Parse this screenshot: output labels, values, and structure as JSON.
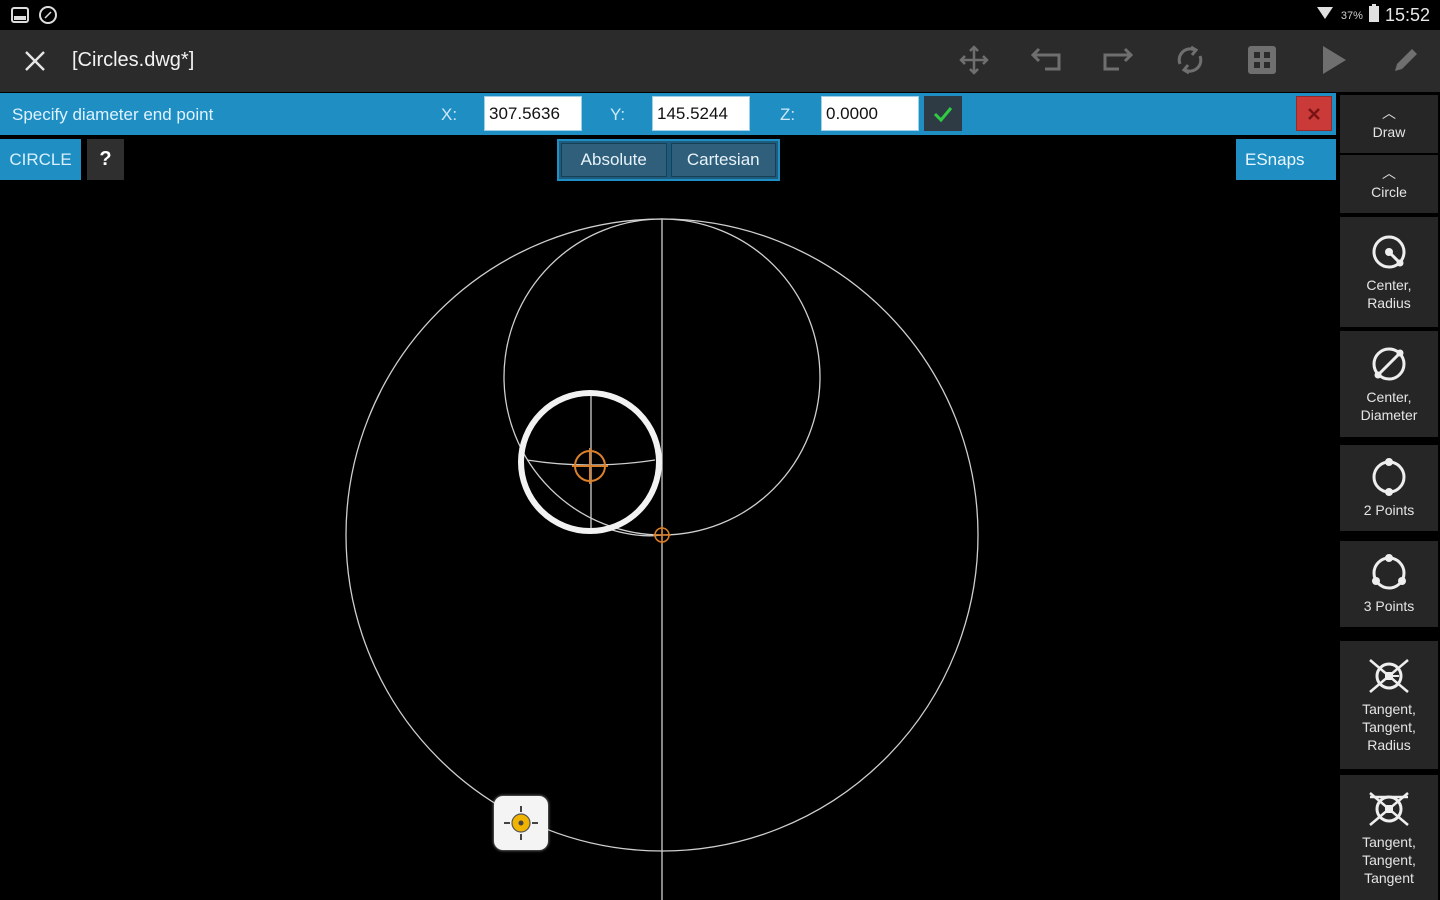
{
  "status_bar": {
    "left_icons": [
      "gallery-icon",
      "compass-icon"
    ],
    "battery": "37%",
    "time": "15:52"
  },
  "toolbar": {
    "document_title": "[Circles.dwg*]",
    "icons": [
      "move-icon",
      "undo-icon",
      "redo-icon",
      "refresh-icon",
      "grid-icon",
      "play-icon",
      "pencil-icon"
    ]
  },
  "command_bar": {
    "prompt": "Specify diameter end point",
    "x_label": "X:",
    "x_value": "307.5636",
    "y_label": "Y:",
    "y_value": "145.5244",
    "z_label": "Z:",
    "z_value": "0.0000",
    "confirm_color": "#2ecc40",
    "cancel_color": "#c93a38"
  },
  "command_row": {
    "command_name": "CIRCLE",
    "help_label": "?",
    "toggle_absolute": "Absolute",
    "toggle_cartesian": "Cartesian",
    "esnaps_label": "ESnaps"
  },
  "right_panel": {
    "items": [
      {
        "label": "Draw",
        "icon": "caret-up-icon"
      },
      {
        "label": "Circle",
        "icon": "caret-up-icon"
      },
      {
        "label": "Center,\nRadius",
        "icon": "circle-center-radius-icon"
      },
      {
        "label": "Center,\nDiameter",
        "icon": "circle-center-diameter-icon"
      },
      {
        "label": "2 Points",
        "icon": "circle-2-points-icon"
      },
      {
        "label": "3 Points",
        "icon": "circle-3-points-icon"
      },
      {
        "label": "Tangent,\nTangent,\nRadius",
        "icon": "circle-ttr-icon"
      },
      {
        "label": "Tangent,\nTangent,\nTangent",
        "icon": "circle-ttt-icon"
      }
    ]
  },
  "colors": {
    "accent": "#1e8ec3",
    "toolbar_bg": "#2b2b2b",
    "snap_orange": "#d9822b",
    "marker_yellow": "#f0b400"
  }
}
